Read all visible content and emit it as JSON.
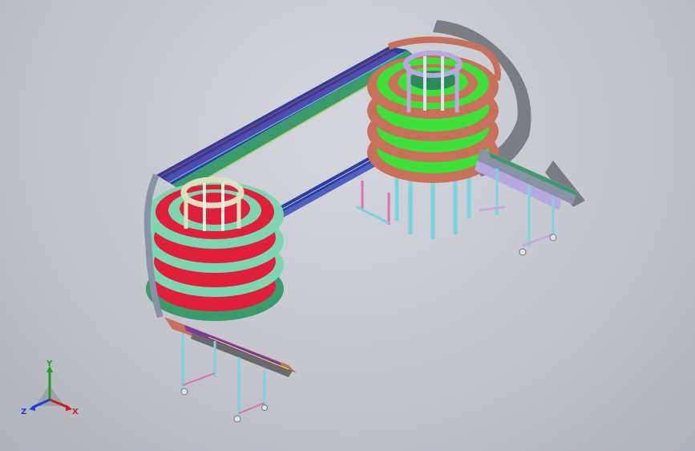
{
  "viewport": {
    "background_top": "#d4d7dd",
    "background_bottom": "#aeb2ba"
  },
  "triad": {
    "x_label": "X",
    "y_label": "Y",
    "z_label": "Z",
    "x_color": "#d01c1c",
    "y_color": "#1aa01a",
    "z_color": "#1f3fd6"
  },
  "model": {
    "colors": {
      "belt_blue": "#2a3fa0",
      "belt_green": "#3a9a6a",
      "ring_salmon": "#c8705a",
      "ring_mint": "#7ed6b0",
      "ring_red": "#e0203a",
      "ring_green": "#3ee03a",
      "column_lavender": "#b8a8e0",
      "frame_gray": "#8a92a8",
      "leg_cyan": "#7ad4e0",
      "leg_pink": "#e070b0"
    }
  }
}
